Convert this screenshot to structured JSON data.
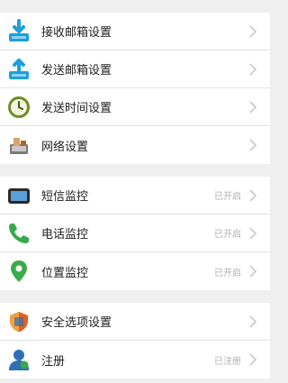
{
  "groups": [
    {
      "items": [
        {
          "label": "接收邮箱设置",
          "icon": "inbox-download-icon"
        },
        {
          "label": "发送邮箱设置",
          "icon": "upload-icon"
        },
        {
          "label": "发送时间设置",
          "icon": "clock-icon"
        },
        {
          "label": "网络设置",
          "icon": "network-computer-icon"
        }
      ]
    },
    {
      "items": [
        {
          "label": "短信监控",
          "icon": "phone-device-icon",
          "status": "已开启"
        },
        {
          "label": "电话监控",
          "icon": "phone-handset-icon",
          "status": "已开启"
        },
        {
          "label": "位置监控",
          "icon": "location-pin-icon",
          "status": "已开启"
        }
      ]
    },
    {
      "items": [
        {
          "label": "安全选项设置",
          "icon": "shield-icon"
        },
        {
          "label": "注册",
          "icon": "user-icon",
          "status": "已注册"
        }
      ]
    }
  ],
  "colors": {
    "accent_blue": "#1aa0dc",
    "accent_green": "#36a94b",
    "chevron": "#c8c8c8",
    "status_text": "#b0b0b0",
    "background": "#efefef"
  }
}
